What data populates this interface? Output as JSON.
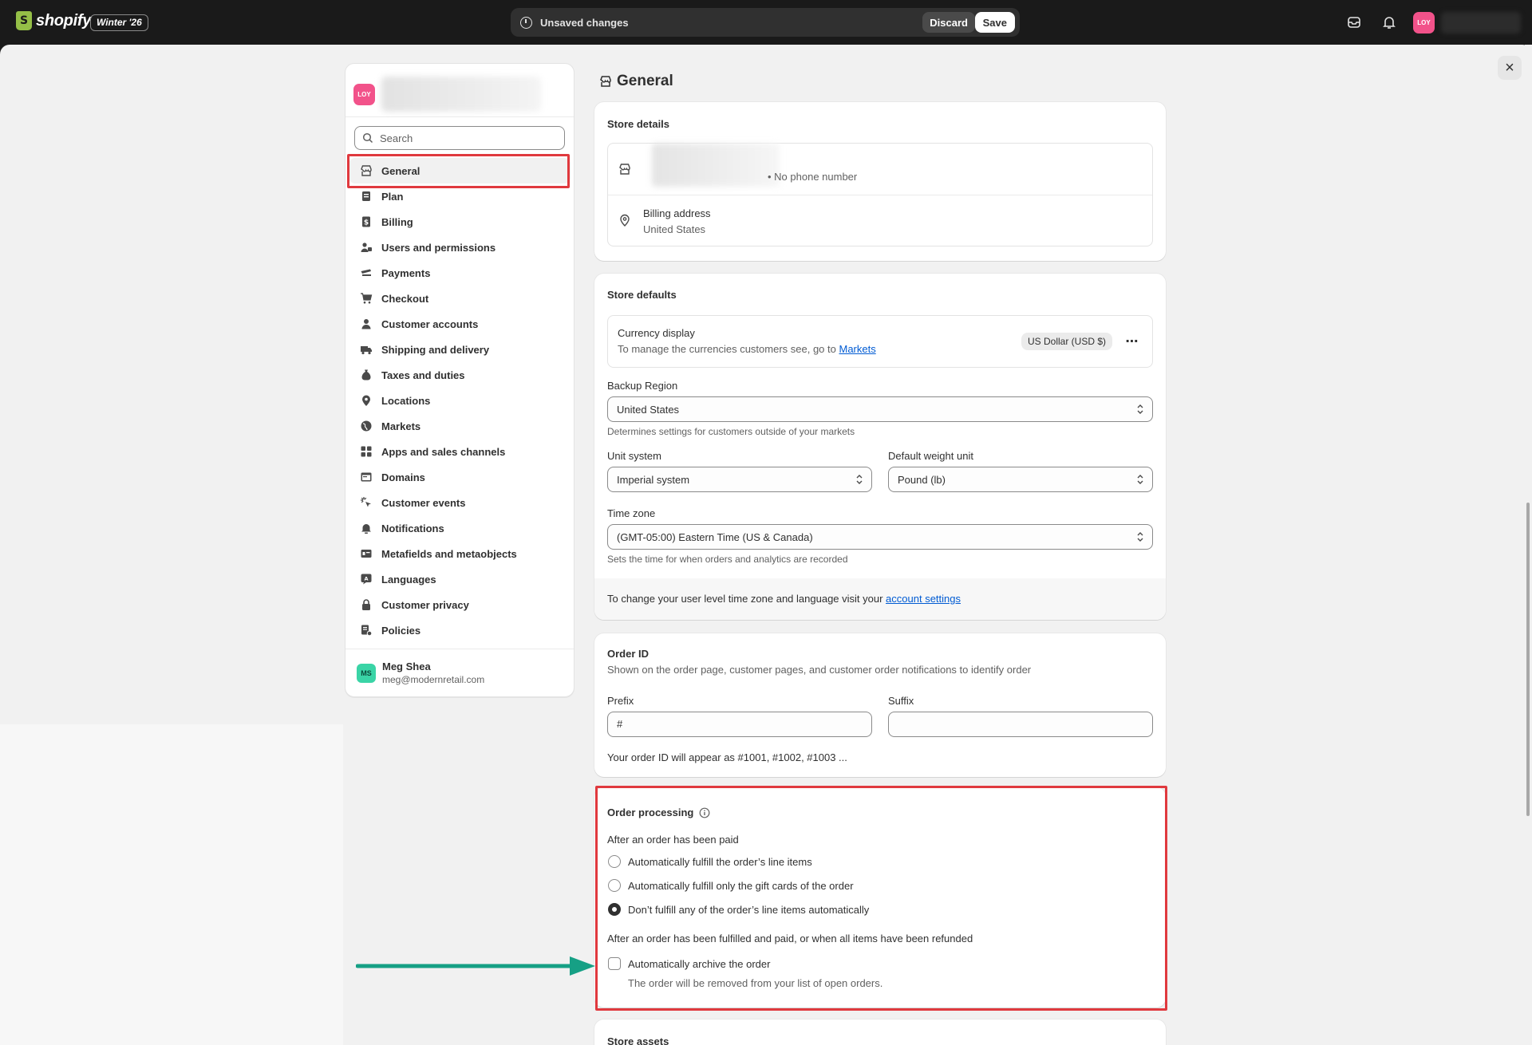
{
  "topbar": {
    "brand": "shopify",
    "edition": "Winter '26",
    "unsaved_label": "Unsaved changes",
    "discard_label": "Discard",
    "save_label": "Save",
    "avatar_initials": "LOY",
    "icons": [
      "info-icon",
      "inbox-icon",
      "bell-icon"
    ]
  },
  "sidebar": {
    "store_initials": "LOY",
    "search_placeholder": "Search",
    "items": [
      {
        "label": "General",
        "icon": "store-icon",
        "active": true
      },
      {
        "label": "Plan",
        "icon": "plan-icon"
      },
      {
        "label": "Billing",
        "icon": "billing-icon"
      },
      {
        "label": "Users and permissions",
        "icon": "users-icon"
      },
      {
        "label": "Payments",
        "icon": "payments-icon"
      },
      {
        "label": "Checkout",
        "icon": "cart-icon"
      },
      {
        "label": "Customer accounts",
        "icon": "person-icon"
      },
      {
        "label": "Shipping and delivery",
        "icon": "truck-icon"
      },
      {
        "label": "Taxes and duties",
        "icon": "tax-icon"
      },
      {
        "label": "Locations",
        "icon": "location-icon"
      },
      {
        "label": "Markets",
        "icon": "globe-icon"
      },
      {
        "label": "Apps and sales channels",
        "icon": "apps-icon"
      },
      {
        "label": "Domains",
        "icon": "domain-icon"
      },
      {
        "label": "Customer events",
        "icon": "cursor-icon"
      },
      {
        "label": "Notifications",
        "icon": "bell-icon"
      },
      {
        "label": "Metafields and metaobjects",
        "icon": "metafield-icon"
      },
      {
        "label": "Languages",
        "icon": "language-icon"
      },
      {
        "label": "Customer privacy",
        "icon": "lock-icon"
      },
      {
        "label": "Policies",
        "icon": "policy-icon"
      }
    ],
    "user": {
      "initials": "MS",
      "name": "Meg Shea",
      "email": "meg@modernretail.com"
    }
  },
  "page": {
    "title": "General",
    "store_details": {
      "title": "Store details",
      "phone": "• No phone number",
      "billing_label": "Billing address",
      "billing_value": "United States"
    },
    "store_defaults": {
      "title": "Store defaults",
      "currency_label": "Currency display",
      "currency_help": "To manage the currencies customers see, go to ",
      "currency_link": "Markets",
      "currency_value": "US Dollar (USD $)",
      "backup_region_label": "Backup Region",
      "backup_region_value": "United States",
      "backup_region_help": "Determines settings for customers outside of your markets",
      "unit_system_label": "Unit system",
      "unit_system_value": "Imperial system",
      "weight_unit_label": "Default weight unit",
      "weight_unit_value": "Pound (lb)",
      "timezone_label": "Time zone",
      "timezone_value": "(GMT-05:00) Eastern Time (US & Canada)",
      "timezone_help": "Sets the time for when orders and analytics are recorded",
      "footer_text": "To change your user level time zone and language visit your ",
      "footer_link": "account settings"
    },
    "order_id": {
      "title": "Order ID",
      "description": "Shown on the order page, customer pages, and customer order notifications to identify order",
      "prefix_label": "Prefix",
      "prefix_value": "#",
      "suffix_label": "Suffix",
      "suffix_value": "",
      "preview": "Your order ID will appear as #1001, #1002, #1003 ..."
    },
    "order_processing": {
      "title": "Order processing",
      "paid_heading": "After an order has been paid",
      "options": [
        {
          "label": "Automatically fulfill the order’s line items",
          "checked": false
        },
        {
          "label": "Automatically fulfill only the gift cards of the order",
          "checked": false
        },
        {
          "label": "Don’t fulfill any of the order’s line items automatically",
          "checked": true
        }
      ],
      "fulfilled_heading": "After an order has been fulfilled and paid, or when all items have been refunded",
      "archive_label": "Automatically archive the order",
      "archive_checked": false,
      "archive_help": "The order will be removed from your list of open orders."
    },
    "store_assets": {
      "title": "Store assets"
    }
  },
  "colors": {
    "highlight": "#e0393e",
    "arrow": "#16a085",
    "link": "#005bd3",
    "store_avatar": "#f2528a",
    "user_avatar": "#3ad4a6"
  }
}
